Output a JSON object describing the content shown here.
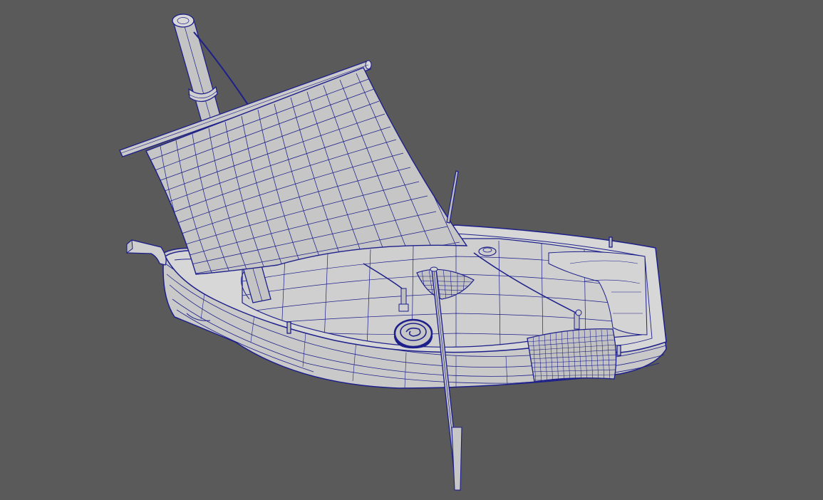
{
  "viewport": {
    "background": "#5a5a5a",
    "shading": "#c9c9c9",
    "wireframe": "#1d1f8a"
  },
  "model": {
    "parts": [
      "mast-icon",
      "yard-icon",
      "sail-icon",
      "hull-icon",
      "deck-icon",
      "oar-icon",
      "rope-coil-icon",
      "cloth-icon",
      "bowsprit-icon",
      "rigging-line-icon"
    ]
  }
}
